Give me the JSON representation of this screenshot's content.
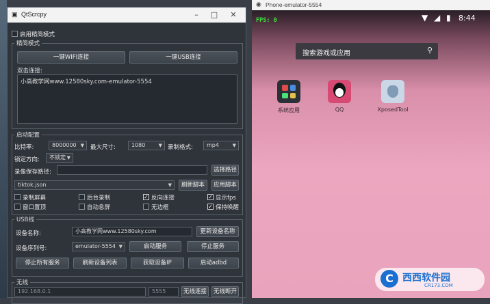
{
  "qtscrcpy": {
    "title": "QtScrcpy",
    "always_on_top": "启用精简模式",
    "wireless_section": "精简模式",
    "btn_wifi": "一键WIFI连接",
    "btn_usb": "一键USB连接",
    "double_click_label": "双击连接:",
    "device_entry": "小高教学网www.12580sky.com-emulator-5554",
    "startup_section": "启动配置",
    "bitrate_label": "比特率:",
    "bitrate_value": "8000000",
    "maxsize_label": "最大尺寸:",
    "maxsize_value": "1080",
    "record_format_label": "录制格式:",
    "record_format_value": "mp4",
    "lock_orient_label": "锁定方向:",
    "lock_orient_value": "不锁定",
    "record_path_label": "录像保存路径:",
    "record_path_value": "",
    "select_path_btn": "选择路径",
    "script_value": "tiktok.json",
    "refresh_script_btn": "刷新脚本",
    "apply_script_btn": "应用脚本",
    "options": [
      {
        "label": "录制屏幕",
        "checked": false
      },
      {
        "label": "后台录制",
        "checked": false
      },
      {
        "label": "反向连接",
        "checked": true
      },
      {
        "label": "显示fps",
        "checked": true
      },
      {
        "label": "窗口置顶",
        "checked": false
      },
      {
        "label": "自动息屏",
        "checked": false
      },
      {
        "label": "无边框",
        "checked": false
      },
      {
        "label": "保持唤醒",
        "checked": true
      }
    ],
    "usb_section": "USB线",
    "device_name_label": "设备名称:",
    "device_name_value": "小高教学网www.12580sky.com",
    "update_name_btn": "更新设备名称",
    "serial_label": "设备序列号:",
    "serial_value": "emulator-5554",
    "start_service_btn": "启动服务",
    "stop_service_btn": "停止服务",
    "stop_all_btn": "停止所有服务",
    "refresh_devices_btn": "刷新设备列表",
    "get_ip_btn": "获取设备IP",
    "start_adbd_btn": "启动adbd",
    "wifi_section": "无线",
    "ip_value": "192.168.0.1",
    "port_value": "5555",
    "wifi_connect_btn": "无线连接",
    "wifi_disconnect_btn": "无线断开"
  },
  "phone": {
    "title": "Phone-emulator-5554",
    "fps": "FPS: 0",
    "time": "8:44",
    "search_placeholder": "搜索游戏或应用",
    "apps": [
      {
        "name": "系统应用",
        "color": "#2b3036"
      },
      {
        "name": "QQ",
        "color": "#d64a74"
      },
      {
        "name": "XposedTool",
        "color": "#c9d7e6"
      }
    ]
  },
  "watermark": {
    "badge_text": "西西软件园",
    "badge_url": "CR173.COM"
  }
}
